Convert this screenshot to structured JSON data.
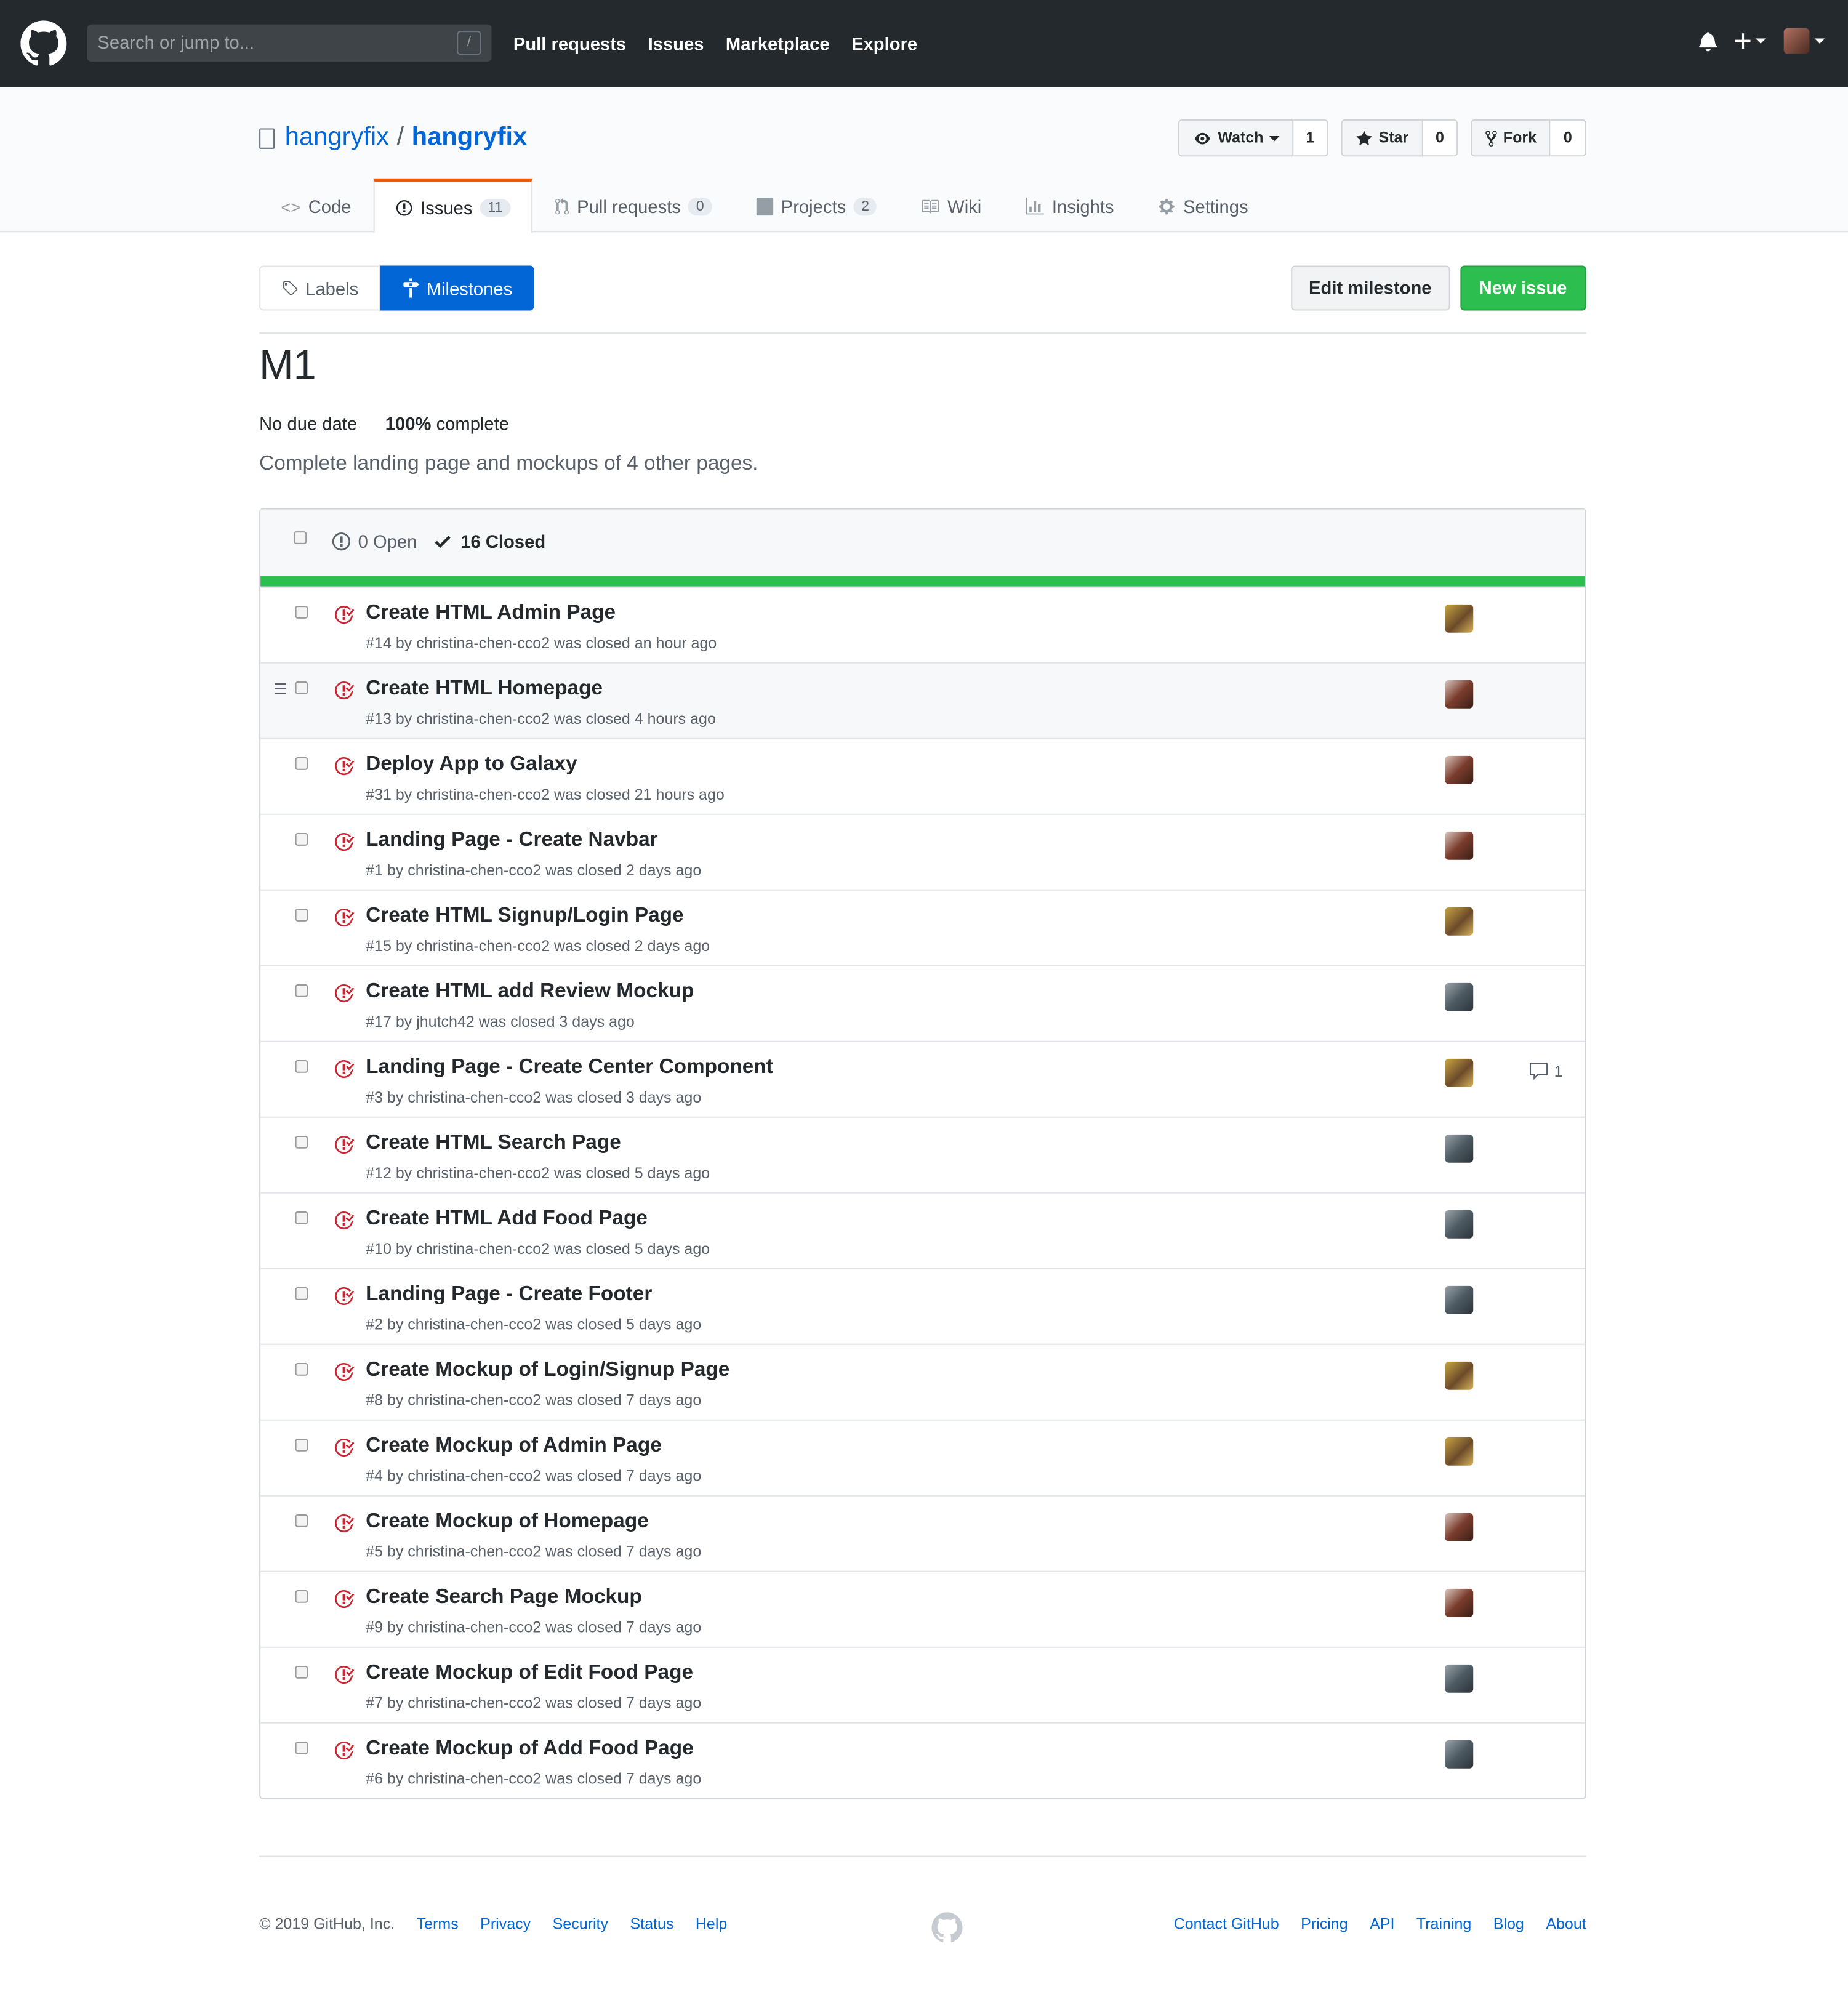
{
  "header": {
    "search_placeholder": "Search or jump to...",
    "search_hint": "/",
    "nav": [
      "Pull requests",
      "Issues",
      "Marketplace",
      "Explore"
    ]
  },
  "repo": {
    "owner": "hangryfix",
    "separator": "/",
    "name": "hangryfix",
    "watch_label": "Watch",
    "watch_count": "1",
    "star_label": "Star",
    "star_count": "0",
    "fork_label": "Fork",
    "fork_count": "0"
  },
  "tabs": [
    {
      "label": "Code",
      "icon": "code-icon"
    },
    {
      "label": "Issues",
      "counter": "11",
      "icon": "issue-icon"
    },
    {
      "label": "Pull requests",
      "counter": "0",
      "icon": "pull-request-icon"
    },
    {
      "label": "Projects",
      "counter": "2",
      "icon": "project-icon"
    },
    {
      "label": "Wiki",
      "icon": "book-icon"
    },
    {
      "label": "Insights",
      "icon": "graph-icon"
    },
    {
      "label": "Settings",
      "icon": "gear-icon"
    }
  ],
  "subnav": {
    "labels": "Labels",
    "milestones": "Milestones",
    "edit_milestone": "Edit milestone",
    "new_issue": "New issue"
  },
  "milestone": {
    "title": "M1",
    "due": "No due date",
    "percent": "100%",
    "complete_word": "complete",
    "description": "Complete landing page and mockups of 4 other pages.",
    "progress": 1.0
  },
  "states": {
    "open": "0 Open",
    "closed": "16 Closed"
  },
  "issues": [
    {
      "title": "Create HTML Admin Page",
      "meta": "#14 by christina-chen-cco2 was closed an hour ago",
      "avatar": "a"
    },
    {
      "title": "Create HTML Homepage",
      "meta": "#13 by christina-chen-cco2 was closed 4 hours ago",
      "avatar": "b"
    },
    {
      "title": "Deploy App to Galaxy",
      "meta": "#31 by christina-chen-cco2 was closed 21 hours ago",
      "avatar": "b"
    },
    {
      "title": "Landing Page - Create Navbar",
      "meta": "#1 by christina-chen-cco2 was closed 2 days ago",
      "avatar": "b"
    },
    {
      "title": "Create HTML Signup/Login Page",
      "meta": "#15 by christina-chen-cco2 was closed 2 days ago",
      "avatar": "a"
    },
    {
      "title": "Create HTML add Review Mockup",
      "meta": "#17 by jhutch42 was closed 3 days ago",
      "avatar": "c"
    },
    {
      "title": "Landing Page - Create Center Component",
      "meta": "#3 by christina-chen-cco2 was closed 3 days ago",
      "avatar": "a",
      "comments": "1"
    },
    {
      "title": "Create HTML Search Page",
      "meta": "#12 by christina-chen-cco2 was closed 5 days ago",
      "avatar": "c"
    },
    {
      "title": "Create HTML Add Food Page",
      "meta": "#10 by christina-chen-cco2 was closed 5 days ago",
      "avatar": "c"
    },
    {
      "title": "Landing Page - Create Footer",
      "meta": "#2 by christina-chen-cco2 was closed 5 days ago",
      "avatar": "c"
    },
    {
      "title": "Create Mockup of Login/Signup Page",
      "meta": "#8 by christina-chen-cco2 was closed 7 days ago",
      "avatar": "a"
    },
    {
      "title": "Create Mockup of Admin Page",
      "meta": "#4 by christina-chen-cco2 was closed 7 days ago",
      "avatar": "a"
    },
    {
      "title": "Create Mockup of Homepage",
      "meta": "#5 by christina-chen-cco2 was closed 7 days ago",
      "avatar": "b"
    },
    {
      "title": "Create Search Page Mockup",
      "meta": "#9 by christina-chen-cco2 was closed 7 days ago",
      "avatar": "b"
    },
    {
      "title": "Create Mockup of Edit Food Page",
      "meta": "#7 by christina-chen-cco2 was closed 7 days ago",
      "avatar": "c"
    },
    {
      "title": "Create Mockup of Add Food Page",
      "meta": "#6 by christina-chen-cco2 was closed 7 days ago",
      "avatar": "c"
    }
  ],
  "footer": {
    "copyright": "© 2019 GitHub, Inc.",
    "left_links": [
      "Terms",
      "Privacy",
      "Security",
      "Status",
      "Help"
    ],
    "right_links": [
      "Contact GitHub",
      "Pricing",
      "API",
      "Training",
      "Blog",
      "About"
    ]
  },
  "colors": {
    "header_bg": "#24292e",
    "link": "#0366d6",
    "closed_red": "#cb2431",
    "green": "#2cbe4e",
    "tab_accent": "#e36209"
  }
}
